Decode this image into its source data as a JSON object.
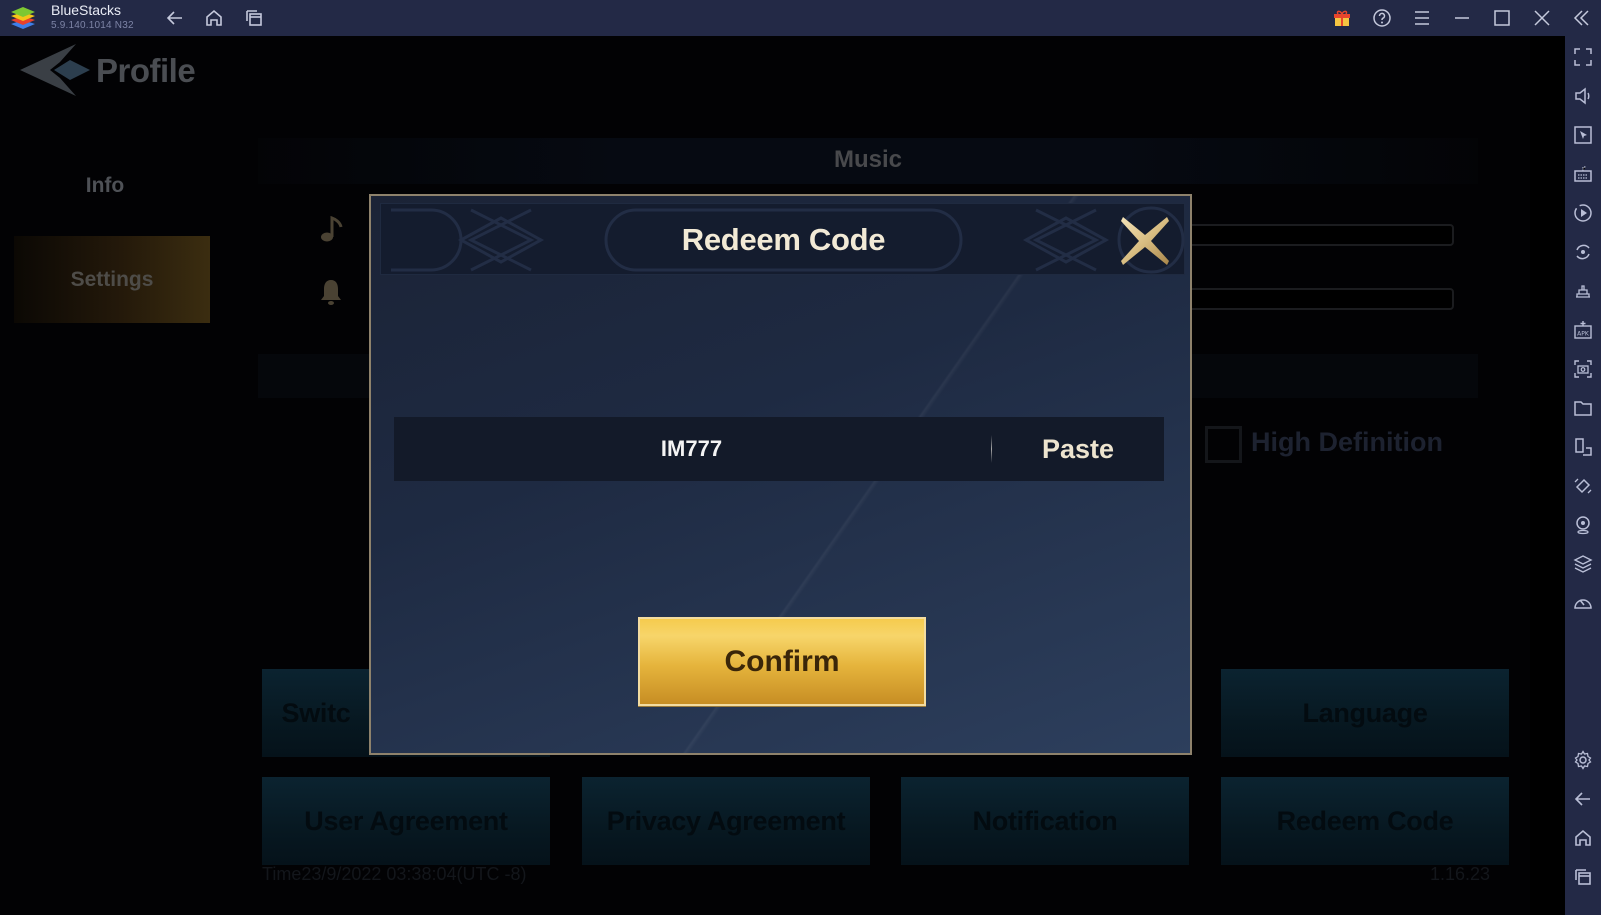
{
  "window": {
    "app_name": "BlueStacks",
    "version": "5.9.140.1014  N32",
    "titlebar_icons": [
      "back-icon",
      "home-icon",
      "multi-instance-icon",
      "gift-icon",
      "help-icon",
      "menu-icon",
      "minimize-icon",
      "maximize-icon",
      "close-icon",
      "collapse-sidebar-icon"
    ]
  },
  "sidebar_tools": [
    "fullscreen-icon",
    "volume-icon",
    "pointer-icon",
    "keyboard-icon",
    "macro-record-icon",
    "sync-icon",
    "gamepad-controls-icon",
    "install-apk-icon",
    "screenshot-icon",
    "folder-icon",
    "multi-window-icon",
    "rotate-icon",
    "location-icon",
    "layers-icon",
    "performance-icon",
    "settings-icon",
    "back-icon",
    "home-icon",
    "recent-apps-icon"
  ],
  "game": {
    "page_title": "Profile",
    "nav": {
      "info": "Info",
      "settings": "Settings"
    },
    "section_header": "Music",
    "high_definition_label": "High Definition",
    "buttons": {
      "switch_partial": "Switc",
      "language": "Language",
      "user_agreement": "User Agreement",
      "privacy_agreement": "Privacy Agreement",
      "notification": "Notification",
      "redeem_code": "Redeem Code"
    },
    "time_text": "Time23/9/2022 03:38:04(UTC -8)",
    "version_text": "1.16.23"
  },
  "dialog": {
    "title": "Redeem Code",
    "code_value": "IM777",
    "paste_label": "Paste",
    "confirm_label": "Confirm"
  },
  "colors": {
    "titlebar_bg": "#232946",
    "dialog_border": "#8e826c",
    "confirm_gold": "#e5b43c",
    "title_text": "#f2ead6"
  }
}
